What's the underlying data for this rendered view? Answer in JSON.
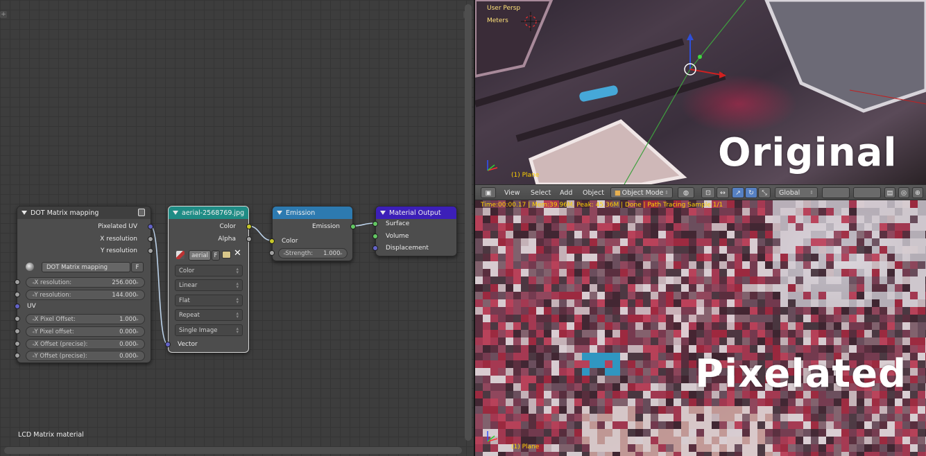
{
  "node_editor": {
    "material_name": "LCD Matrix material",
    "nodes": {
      "dot_matrix": {
        "title": "DOT Matrix mapping",
        "outputs": [
          "Pixelated UV",
          "X resolution",
          "Y resolution"
        ],
        "group_name": "DOT Matrix mapping",
        "fake_user": "F",
        "x_resolution": {
          "label": "X resolution:",
          "value": "256.000"
        },
        "y_resolution": {
          "label": "Y resolution:",
          "value": "144.000"
        },
        "uv_label": "UV",
        "x_pixel_offset": {
          "label": "X Pixel Offset:",
          "value": "1.000"
        },
        "y_pixel_offset": {
          "label": "Y Pixel offset:",
          "value": "0.000"
        },
        "x_offset_precise": {
          "label": "X Offset (precise):",
          "value": "0.000"
        },
        "y_offset_precise": {
          "label": "Y Offset (precise):",
          "value": "0.000"
        }
      },
      "image_texture": {
        "title": "aerial-2568769.jpg",
        "outputs": [
          "Color",
          "Alpha"
        ],
        "image_name": "aerial",
        "fake_user": "F",
        "color_space": "Color",
        "interpolation": "Linear",
        "projection": "Flat",
        "extension": "Repeat",
        "source": "Single Image",
        "vector_label": "Vector"
      },
      "emission": {
        "title": "Emission",
        "output": "Emission",
        "color_label": "Color",
        "strength": {
          "label": "Strength:",
          "value": "1.000"
        }
      },
      "material_output": {
        "title": "Material Output",
        "inputs": [
          "Surface",
          "Volume",
          "Displacement"
        ]
      }
    }
  },
  "viewport_top": {
    "view_label": "User Persp",
    "units_label": "Meters",
    "object_label": "(1) Plane",
    "overlay_text": "Original"
  },
  "viewport_header": {
    "menu": [
      "View",
      "Select",
      "Add",
      "Object"
    ],
    "mode": "Object Mode",
    "orientation": "Global"
  },
  "viewport_bottom": {
    "status": "Time:00:00.17 | Mem:39.96M, Peak: 45.36M | Done | Path Tracing Sample 1/1",
    "object_label": "(1) Plane",
    "overlay_text": "Pixelated"
  },
  "colors": {
    "group_header": "#3f3f3f",
    "texture_header": "#1f8c85",
    "shader_header": "#2d7ab0",
    "output_header": "#3c1fb8",
    "overlay_yellow": "#ffd200"
  }
}
